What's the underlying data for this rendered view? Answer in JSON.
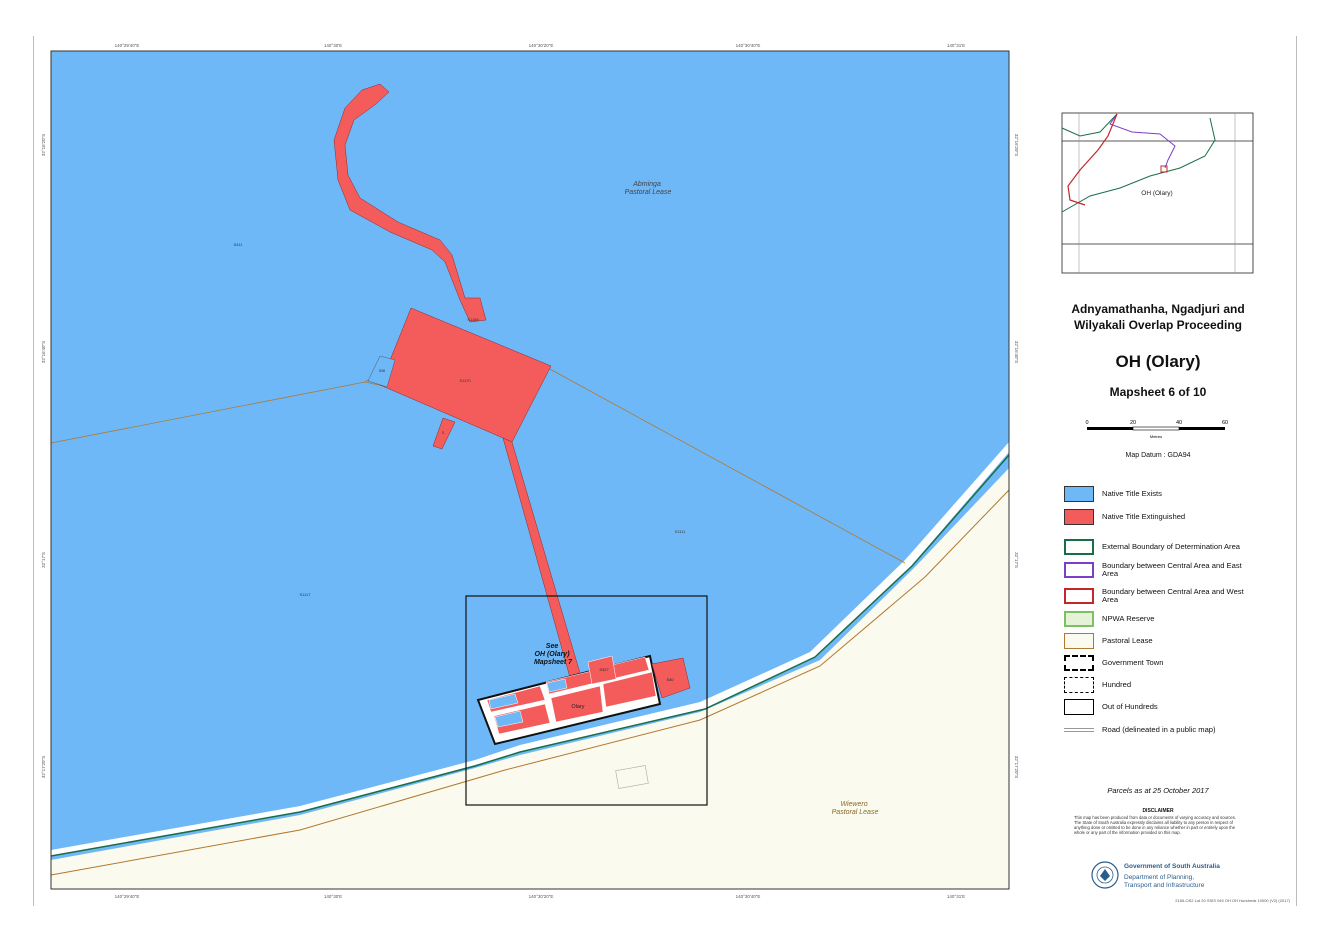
{
  "map": {
    "labels": {
      "arrow_lease": "Abminga\nPastoral Lease",
      "wiewero": "Wiewero\nPastoral Lease",
      "s1188": "S1188",
      "s1170": "S1170",
      "s1111": "S1111",
      "s1117": "S1117",
      "s411": "S411",
      "s98": "S98",
      "s_small": "S",
      "see_mapsheet": "See\nOH (Olary)\nMapsheet 7",
      "olary": "Olary",
      "s327": "S327",
      "s40": "S40"
    },
    "colors": {
      "native_title_exists": "#6fb8f8",
      "native_title_extinguished": "#f45c5c",
      "external_boundary": "#1a6e47",
      "central_east": "#7c3fc7",
      "central_west": "#c0282c",
      "npwa_reserve": "#7cc060",
      "pastoral_lease": "#b07830",
      "background_land": "#fbfaee"
    }
  },
  "inset": {
    "label": "OH (Olary)"
  },
  "title": {
    "line1": "Adnyamathanha, Ngadjuri and",
    "line2": "Wilyakali Overlap Proceeding",
    "name": "OH (Olary)",
    "mapsheet": "Mapsheet 6 of 10"
  },
  "scale": {
    "ticks": [
      "0",
      "20",
      "40",
      "60"
    ],
    "unit": "Metres",
    "datum": "Map Datum : GDA94"
  },
  "legend": [
    {
      "label": "Native Title Exists",
      "icon": "fill-blue"
    },
    {
      "label": "Native Title Extinguished",
      "icon": "fill-red"
    },
    {
      "label": "External Boundary of Determination Area",
      "icon": "outline-green"
    },
    {
      "label": "Boundary between Central Area and East Area",
      "icon": "outline-purple"
    },
    {
      "label": "Boundary between Central Area and West Area",
      "icon": "outline-red"
    },
    {
      "label": "NPWA Reserve",
      "icon": "dotted-green"
    },
    {
      "label": "Pastoral Lease",
      "icon": "outline-brown"
    },
    {
      "label": "Government Town",
      "icon": "dashed-black-thick"
    },
    {
      "label": "Hundred",
      "icon": "dashed-black"
    },
    {
      "label": "Out of Hundreds",
      "icon": "outline-black"
    },
    {
      "label": "Road (delineated in a public map)",
      "icon": "road-line"
    }
  ],
  "footer": {
    "parcels": "Parcels as at 25 October 2017",
    "disclaimer_title": "DISCLAIMER",
    "disclaimer_text": "This map has been produced from data or documents of varying accuracy and sources. The State of South Australia expressly disclaims all liability to any person in respect of anything done or omitted to be done in any reliance whether in part or entirely upon the whole or any part of the information provided on this map.",
    "gov_line1": "Government of South Australia",
    "gov_line2": "Department of Planning,",
    "gov_line3": "Transport and Infrastructure",
    "ref": "2165-OS2 Lot 20 SSIS 045 OH OH Hundreds 10000 (V2) (2017)"
  },
  "coords": {
    "top": [
      "140°29'40\"E",
      "140°30'E",
      "140°30'20\"E",
      "140°30'40\"E",
      "140°31'E"
    ],
    "bottom": [
      "140°29'40\"E",
      "140°30'E",
      "140°30'20\"E",
      "140°30'40\"E",
      "140°31'E"
    ],
    "left": [
      "32°16'20\"S",
      "32°16'40\"S",
      "32°17'S",
      "32°17'20\"S"
    ],
    "right": [
      "32°16'20\"S",
      "32°16'40\"S",
      "32°17'S",
      "32°17'20\"S"
    ]
  }
}
